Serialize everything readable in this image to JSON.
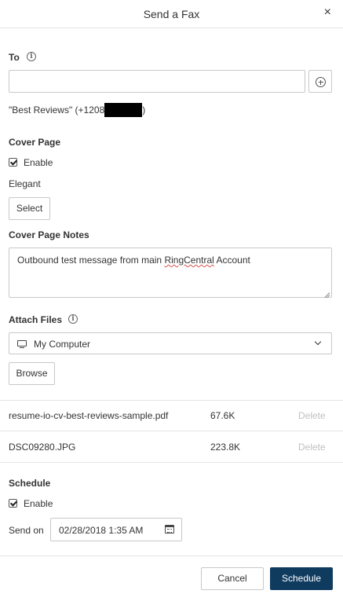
{
  "dialog": {
    "title": "Send a Fax",
    "close_glyph": "×"
  },
  "to": {
    "label": "To",
    "input_value": "",
    "recipient_prefix": "\"Best Reviews\" (+1208",
    "recipient_suffix": ")"
  },
  "cover_page": {
    "label": "Cover Page",
    "enable_label": "Enable",
    "enable_checked": true,
    "template_name": "Elegant",
    "select_label": "Select"
  },
  "notes": {
    "label": "Cover Page Notes",
    "text_before": "Outbound test message from main ",
    "text_misspelled": "RingCentral",
    "text_after": " Account"
  },
  "attach": {
    "label": "Attach Files",
    "source_selected": "My Computer",
    "browse_label": "Browse",
    "files": [
      {
        "name": "resume-io-cv-best-reviews-sample.pdf",
        "size": "67.6K",
        "delete_label": "Delete"
      },
      {
        "name": "DSC09280.JPG",
        "size": "223.8K",
        "delete_label": "Delete"
      }
    ]
  },
  "schedule": {
    "label": "Schedule",
    "enable_label": "Enable",
    "enable_checked": true,
    "send_on_label": "Send on",
    "date_value": "02/28/2018 1:35 AM"
  },
  "footer": {
    "cancel_label": "Cancel",
    "schedule_label": "Schedule",
    "primary_color": "#0f3b5f"
  }
}
